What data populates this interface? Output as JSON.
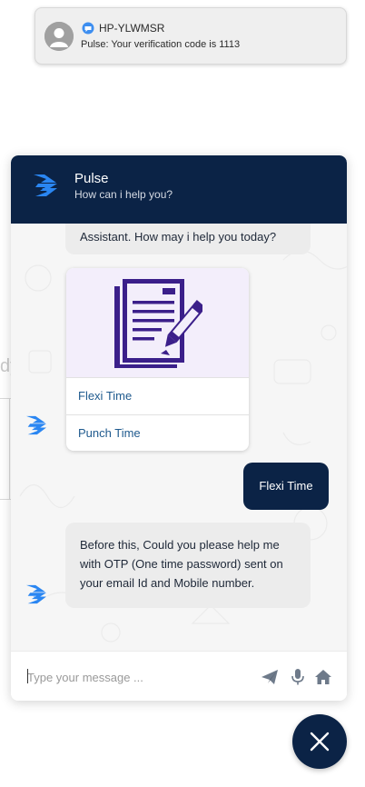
{
  "background": {
    "fragment_text": "dy"
  },
  "notification": {
    "sender": "HP-YLWMSR",
    "message": "Pulse: Your verification code is 1113"
  },
  "chat": {
    "header": {
      "title": "Pulse",
      "subtitle": "How can i help you?"
    },
    "messages": {
      "greeting_tail": "Assistant. How may i help you today?",
      "card_options": [
        "Flexi Time",
        "Punch Time"
      ],
      "user_reply": "Flexi Time",
      "otp_request": "Before this, Could you please help me with OTP (One time password) sent on your email Id and Mobile number."
    },
    "composer": {
      "placeholder": "Type your message ..."
    }
  },
  "colors": {
    "brand_navy": "#0b2346",
    "logo_blue": "#2a86f2",
    "card_purple": "#3b1f8a",
    "option_link": "#1f5a8e"
  },
  "icons": {
    "logo": "pulse-logo-icon",
    "send": "paper-plane-icon",
    "mic": "microphone-icon",
    "home": "home-icon",
    "close": "close-icon",
    "document": "document-pencil-icon"
  }
}
